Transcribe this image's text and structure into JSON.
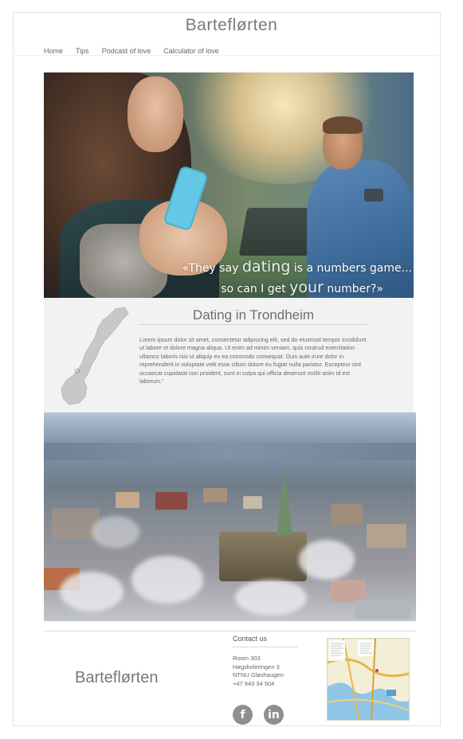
{
  "site": {
    "title": "Barteflørten"
  },
  "nav": {
    "items": [
      "Home",
      "Tips",
      "Podcast of love",
      "Calculator of love"
    ]
  },
  "hero": {
    "quote_line1_pre": "«They say ",
    "quote_line1_em": "dating",
    "quote_line1_post": " is a numbers game...",
    "quote_line2_pre": "so can I get ",
    "quote_line2_em": "your",
    "quote_line2_post": " number?»"
  },
  "intro": {
    "title": "Dating in Trondheim",
    "body": "Lorem ipsum dolor sit amet, consectetur adipiscing elit, sed do eiusmod tempor incididunt ut labore et dolore magna aliqua. Ut enim ad minim veniam, quis nostrud exercitation ullamco laboris nisi ut aliquip ex ea commodo consequat. Duis aute irure dolor in reprehenderit in voluptate velit esse cillum dolore eu fugiat nulla pariatur. Excepteur sint occaecat cupidatat non proident, sunt in culpa qui officia deserunt mollit anim id est laborum.\""
  },
  "footer": {
    "brand": "Barteflørten",
    "contact_title": "Contact us",
    "address_lines": [
      "Room 303",
      "Høgskoleringen 3",
      "NTNU Gløshaugen",
      "+47 943 34 504"
    ],
    "social": {
      "facebook": "f",
      "linkedin": "in"
    }
  },
  "icons": {
    "facebook": "facebook-icon",
    "linkedin": "linkedin-icon",
    "norway_map": "norway-map-icon"
  },
  "colors": {
    "intro_bg": "#f2f2f2",
    "social_bg": "#8f8f8f",
    "phone": "#64c7e6"
  }
}
